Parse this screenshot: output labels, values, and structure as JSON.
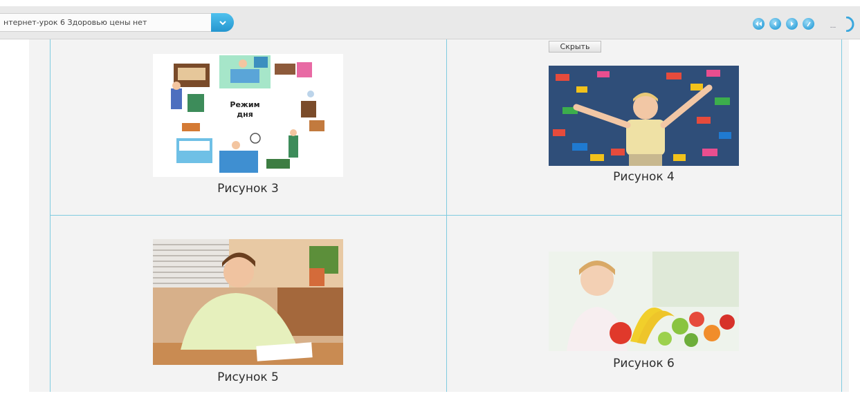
{
  "toolbar": {
    "lesson_title": "нтернет-урок 6  Здоровью цены нет",
    "dropdown_icon": "chevron-down-icon",
    "nav_icons": [
      "first-icon",
      "prev-icon",
      "next-icon",
      "edit-icon"
    ],
    "more_label": "...",
    "accent": "#2596cf"
  },
  "content": {
    "hide_button": "Скрыть",
    "pictures": [
      {
        "caption": "Рисунок 3",
        "image_text": "Режим дня"
      },
      {
        "caption": "Рисунок 4"
      },
      {
        "caption": "Рисунок 5"
      },
      {
        "caption": "Рисунок 6"
      }
    ]
  }
}
